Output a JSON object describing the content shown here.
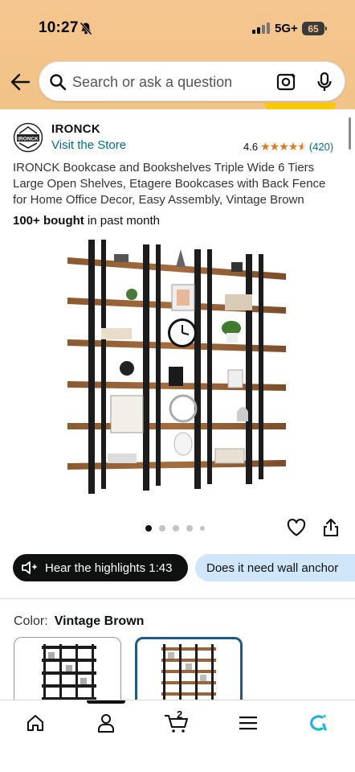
{
  "status_bar": {
    "time": "10:27",
    "network": "5G+",
    "battery": "65"
  },
  "header": {
    "search_placeholder": "Search or ask a question",
    "icons": [
      "back-arrow-icon",
      "search-icon",
      "camera-lens-icon",
      "microphone-icon"
    ]
  },
  "brand": {
    "logo_text": "IRONCK",
    "name": "IRONCK",
    "store_link": "Visit the Store",
    "rating": "4.6",
    "stars": 4.6,
    "rating_count": "(420)"
  },
  "product": {
    "title": "IRONCK Bookcase and Bookshelves Triple Wide 6 Tiers Large Open Shelves, Etagere Bookcases with Back Fence for Home Office Decor, Easy Assembly, Vintage Brown",
    "bought_bold": "100+ bought",
    "bought_rest": " in past month",
    "image_count": 5,
    "active_image": 0
  },
  "chips": {
    "hear_label": "Hear the highlights 1:43",
    "ask_label": "Does it need wall anchor"
  },
  "variant": {
    "label": "Color:",
    "value": "Vintage Brown",
    "options": [
      "Black",
      "Vintage Brown"
    ],
    "selected": 1
  },
  "bottom_nav": {
    "items": [
      "home-icon",
      "account-icon",
      "cart-icon",
      "menu-icon",
      "rufus-icon"
    ],
    "cart_count": "2",
    "active": 1
  },
  "colors": {
    "header_bg": "#f5c690",
    "link": "#007185",
    "star": "#de7921",
    "chip_dark": "#0f1111",
    "chip_light": "#cfe6fb",
    "selected_border": "#1e5a8a"
  }
}
